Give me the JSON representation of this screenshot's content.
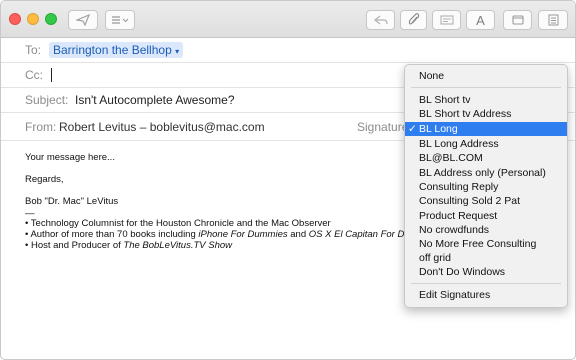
{
  "toolbar": {
    "send_icon": "paper-plane-icon",
    "list_icon": "header-fields-icon",
    "font_label": "A"
  },
  "colors": {
    "accent": "#2f7ef0",
    "close": "#fc605b",
    "minimize": "#fdbc40",
    "zoom": "#34c84a"
  },
  "header": {
    "to_label": "To:",
    "to_value": "Barrington the Bellhop",
    "cc_label": "Cc:",
    "subject_label": "Subject:",
    "subject_value": "Isn't Autocomplete Awesome?",
    "from_label": "From:",
    "from_value": "Robert Levitus – boblevitus@mac.com",
    "signature_label": "Signature"
  },
  "body": {
    "line1": "Your message here...",
    "line2": "Regards,",
    "line3": "Bob \"Dr. Mac\" LeVitus",
    "line4": "—",
    "bullet1_a": "• Technology Columnist for the Houston Chronicle and the Mac Observer",
    "bullet2_a": "• Author of more than 70 books including ",
    "bullet2_b": "iPhone For Dummies",
    "bullet2_c": " and ",
    "bullet2_d": "OS X El Capitan For D",
    "bullet3_a": "• Host and Producer of ",
    "bullet3_b": "The BobLeVitus.TV Show"
  },
  "signature_menu": {
    "check": "✓",
    "items": [
      "None",
      "BL Short tv",
      "BL Short tv Address",
      "BL Long",
      "BL Long Address",
      "BL@BL.COM",
      "BL Address only (Personal)",
      "Consulting Reply",
      "Consulting Sold 2 Pat",
      "Product Request",
      "No crowdfunds",
      "No More Free Consulting",
      "off grid",
      "Don't Do Windows",
      "Edit Signatures"
    ],
    "selected": "BL Long"
  }
}
